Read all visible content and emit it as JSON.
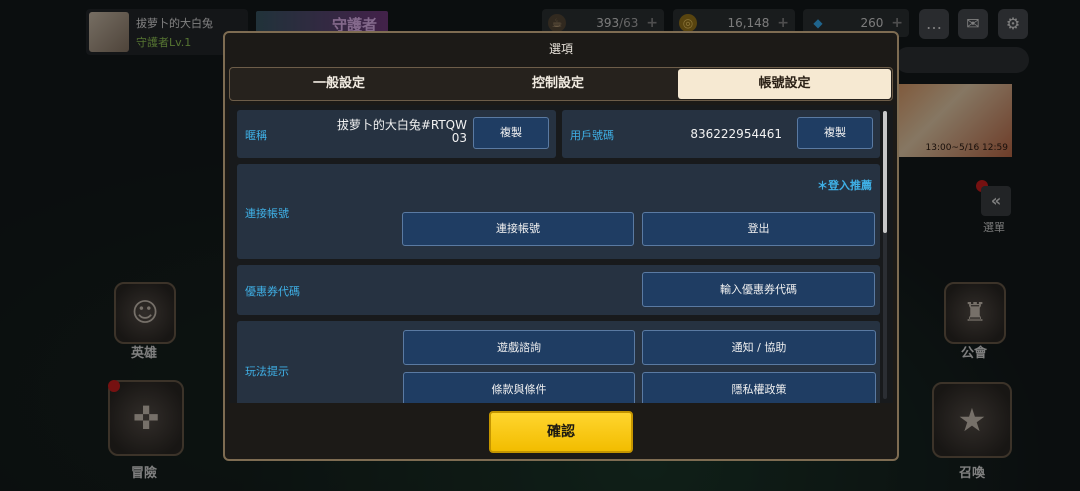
{
  "player": {
    "name": "拔萝卜的大白兔",
    "level": "守護者Lv.1"
  },
  "top_banner": {
    "text": "守護者"
  },
  "resources": {
    "stamina": {
      "current": "393",
      "max": "/63"
    },
    "gold": "16,148",
    "gems": "260",
    "plus": "+"
  },
  "side_banner": {
    "text": "13:00~5/16 12:59"
  },
  "menu": {
    "label": "選單",
    "toggle": "«"
  },
  "nav": {
    "hero": "英雄",
    "adventure": "冒險",
    "guild": "公會",
    "summon": "召喚"
  },
  "modal": {
    "title": "選項",
    "tabs": [
      {
        "label": "一般設定",
        "active": false
      },
      {
        "label": "控制設定",
        "active": false
      },
      {
        "label": "帳號設定",
        "active": true
      }
    ],
    "nickname": {
      "label": "暱稱",
      "value_line1": "拔萝卜的大白兔#RTQW",
      "value_line2": "03",
      "copy_label": "複製"
    },
    "user_id": {
      "label": "用戶號碼",
      "value": "836222954461",
      "copy_label": "複製"
    },
    "link_account": {
      "label": "連接帳號",
      "recommend": "＊登入推薦",
      "link_button": "連接帳號",
      "logout_button": "登出"
    },
    "coupon": {
      "label": "優惠券代碼",
      "button": "輸入優惠券代碼"
    },
    "tips": {
      "label": "玩法提示",
      "buttons": [
        "遊戲諮詢",
        "通知 / 協助",
        "條款與條件",
        "隱私權政策"
      ]
    },
    "confirm_label": "確認"
  }
}
